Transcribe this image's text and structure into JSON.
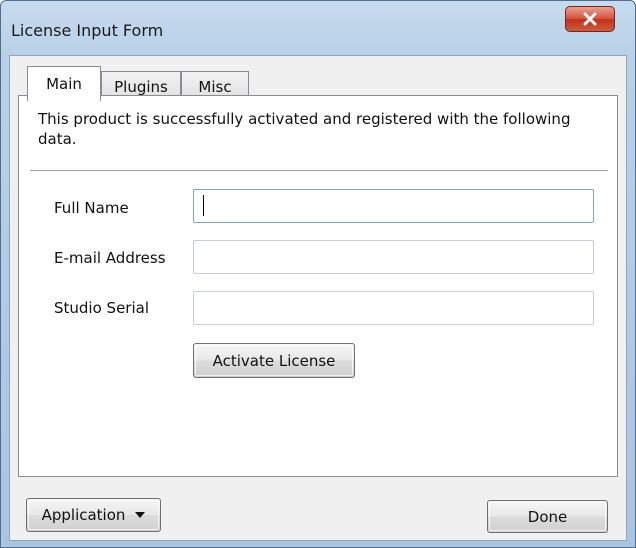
{
  "window": {
    "title": "License Input Form",
    "close_glyph": "✕"
  },
  "tabs": [
    {
      "label": "Main",
      "active": true
    },
    {
      "label": "Plugins",
      "active": false
    },
    {
      "label": "Misc",
      "active": false
    }
  ],
  "main": {
    "intro_text": "This product is successfully activated and registered with the following data.",
    "fields": {
      "full_name": {
        "label": "Full Name",
        "value": ""
      },
      "email": {
        "label": "E-mail Address",
        "value": ""
      },
      "serial": {
        "label": "Studio Serial",
        "value": ""
      }
    },
    "activate_label": "Activate License"
  },
  "footer": {
    "application_label": "Application",
    "done_label": "Done"
  },
  "icons": {
    "close": "close-icon",
    "dropdown": "chevron-down-icon"
  },
  "colors": {
    "titlebar": "#b9d0e8",
    "close_button": "#c9442c",
    "client_bg": "#f0f0f0",
    "panel_bg": "#ffffff"
  }
}
